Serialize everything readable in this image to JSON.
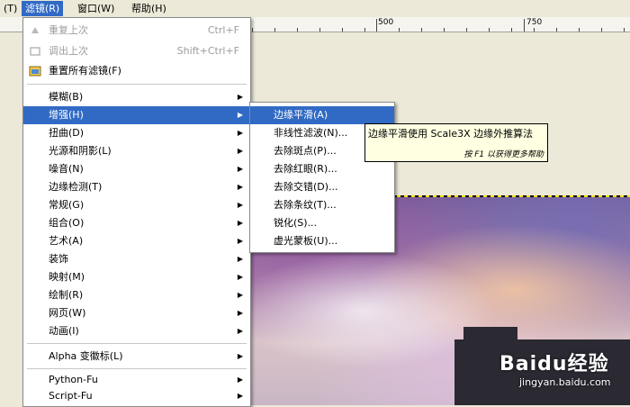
{
  "menubar": {
    "items": [
      {
        "label": "(T)"
      },
      {
        "label": "滤镜(R)"
      },
      {
        "label": "窗口(W)"
      },
      {
        "label": "帮助(H)"
      }
    ]
  },
  "ruler": {
    "labels": [
      "500",
      "750"
    ]
  },
  "filters_menu": {
    "items": [
      {
        "label": "重复上次",
        "accel": "Ctrl+F",
        "disabled": true,
        "icon": "repeat-icon"
      },
      {
        "label": "调出上次",
        "accel": "Shift+Ctrl+F",
        "disabled": true,
        "icon": "reshow-icon"
      },
      {
        "label": "重置所有滤镜(F)",
        "accel": "",
        "icon": "reset-icon"
      },
      {
        "label": "模糊(B)"
      },
      {
        "label": "增强(H)"
      },
      {
        "label": "扭曲(D)"
      },
      {
        "label": "光源和阴影(L)"
      },
      {
        "label": "噪音(N)"
      },
      {
        "label": "边缘检测(T)"
      },
      {
        "label": "常规(G)"
      },
      {
        "label": "组合(O)"
      },
      {
        "label": "艺术(A)"
      },
      {
        "label": "装饰"
      },
      {
        "label": "映射(M)"
      },
      {
        "label": "绘制(R)"
      },
      {
        "label": "网页(W)"
      },
      {
        "label": "动画(I)"
      },
      {
        "label": "Alpha 变徽标(L)"
      },
      {
        "label": "Python-Fu"
      },
      {
        "label": "Script-Fu"
      }
    ]
  },
  "enhance_submenu": {
    "items": [
      {
        "label": "边缘平滑(A)"
      },
      {
        "label": "非线性滤波(N)..."
      },
      {
        "label": "去除斑点(P)..."
      },
      {
        "label": "去除红眼(R)..."
      },
      {
        "label": "去除交错(D)..."
      },
      {
        "label": "去除条纹(T)..."
      },
      {
        "label": "锐化(S)..."
      },
      {
        "label": "虚光蒙板(U)..."
      }
    ]
  },
  "tooltip": {
    "text": "边缘平滑使用 Scale3X 边缘外推算法",
    "hint": "按 F1 以获得更多帮助"
  },
  "watermark": {
    "brand": "Baidu经验",
    "url": "jingyan.baidu.com"
  },
  "colors": {
    "highlight": "#316ac5",
    "tooltip_bg": "#ffffe1"
  }
}
